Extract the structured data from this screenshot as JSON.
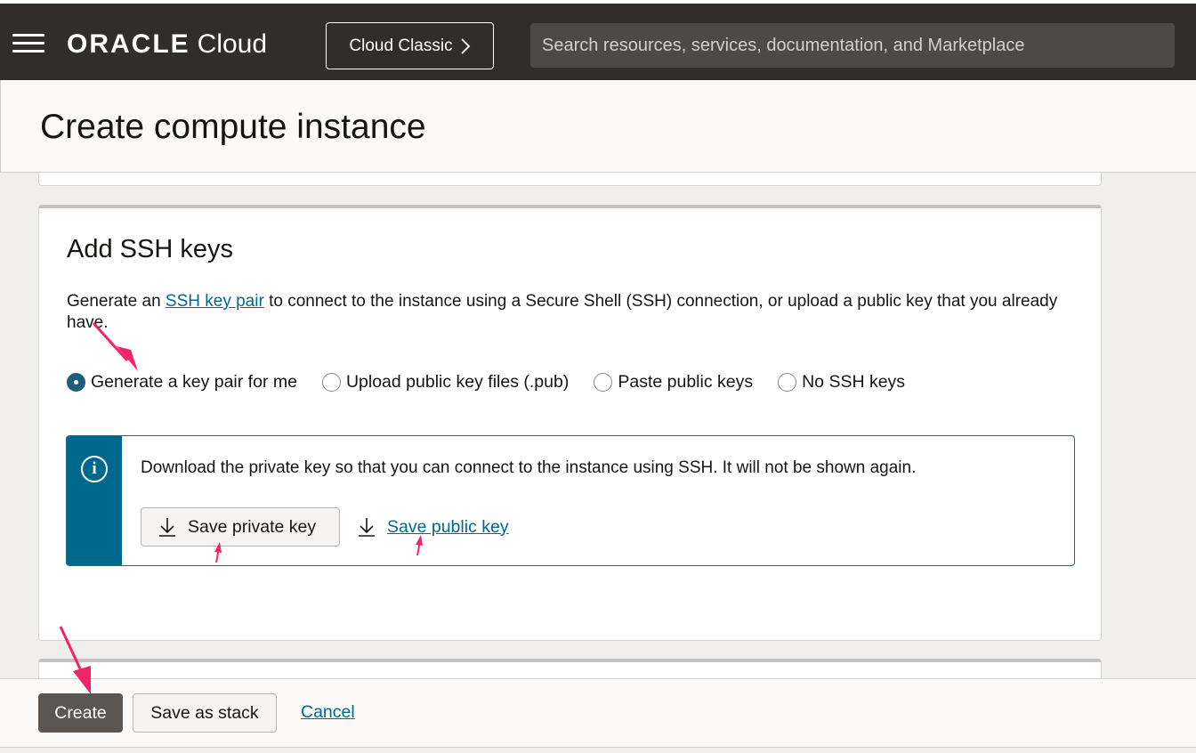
{
  "header": {
    "brand_oracle": "ORACLE",
    "brand_cloud": "Cloud",
    "classic_button_label": "Cloud Classic",
    "search_placeholder": "Search resources, services, documentation, and Marketplace"
  },
  "page": {
    "title": "Create compute instance"
  },
  "ssh_section": {
    "title": "Add SSH keys",
    "description_prefix": "Generate an ",
    "description_link": "SSH key pair",
    "description_suffix": " to connect to the instance using a Secure Shell (SSH) connection, or upload a public key that you already have.",
    "options": [
      {
        "label": "Generate a key pair for me",
        "selected": true
      },
      {
        "label": "Upload public key files (.pub)",
        "selected": false
      },
      {
        "label": "Paste public keys",
        "selected": false
      },
      {
        "label": "No SSH keys",
        "selected": false
      }
    ],
    "info": {
      "icon": "info-icon",
      "message": "Download the private key so that you can connect to the instance using SSH. It will not be shown again.",
      "save_private_label": "Save private key",
      "save_public_label": "Save public key"
    }
  },
  "footer": {
    "create_label": "Create",
    "save_stack_label": "Save as stack",
    "cancel_label": "Cancel"
  },
  "colors": {
    "header_bg": "#312d2a",
    "accent_blue": "#00688c",
    "annotation_arrow": "#f0246a",
    "create_button": "#5b5652"
  }
}
